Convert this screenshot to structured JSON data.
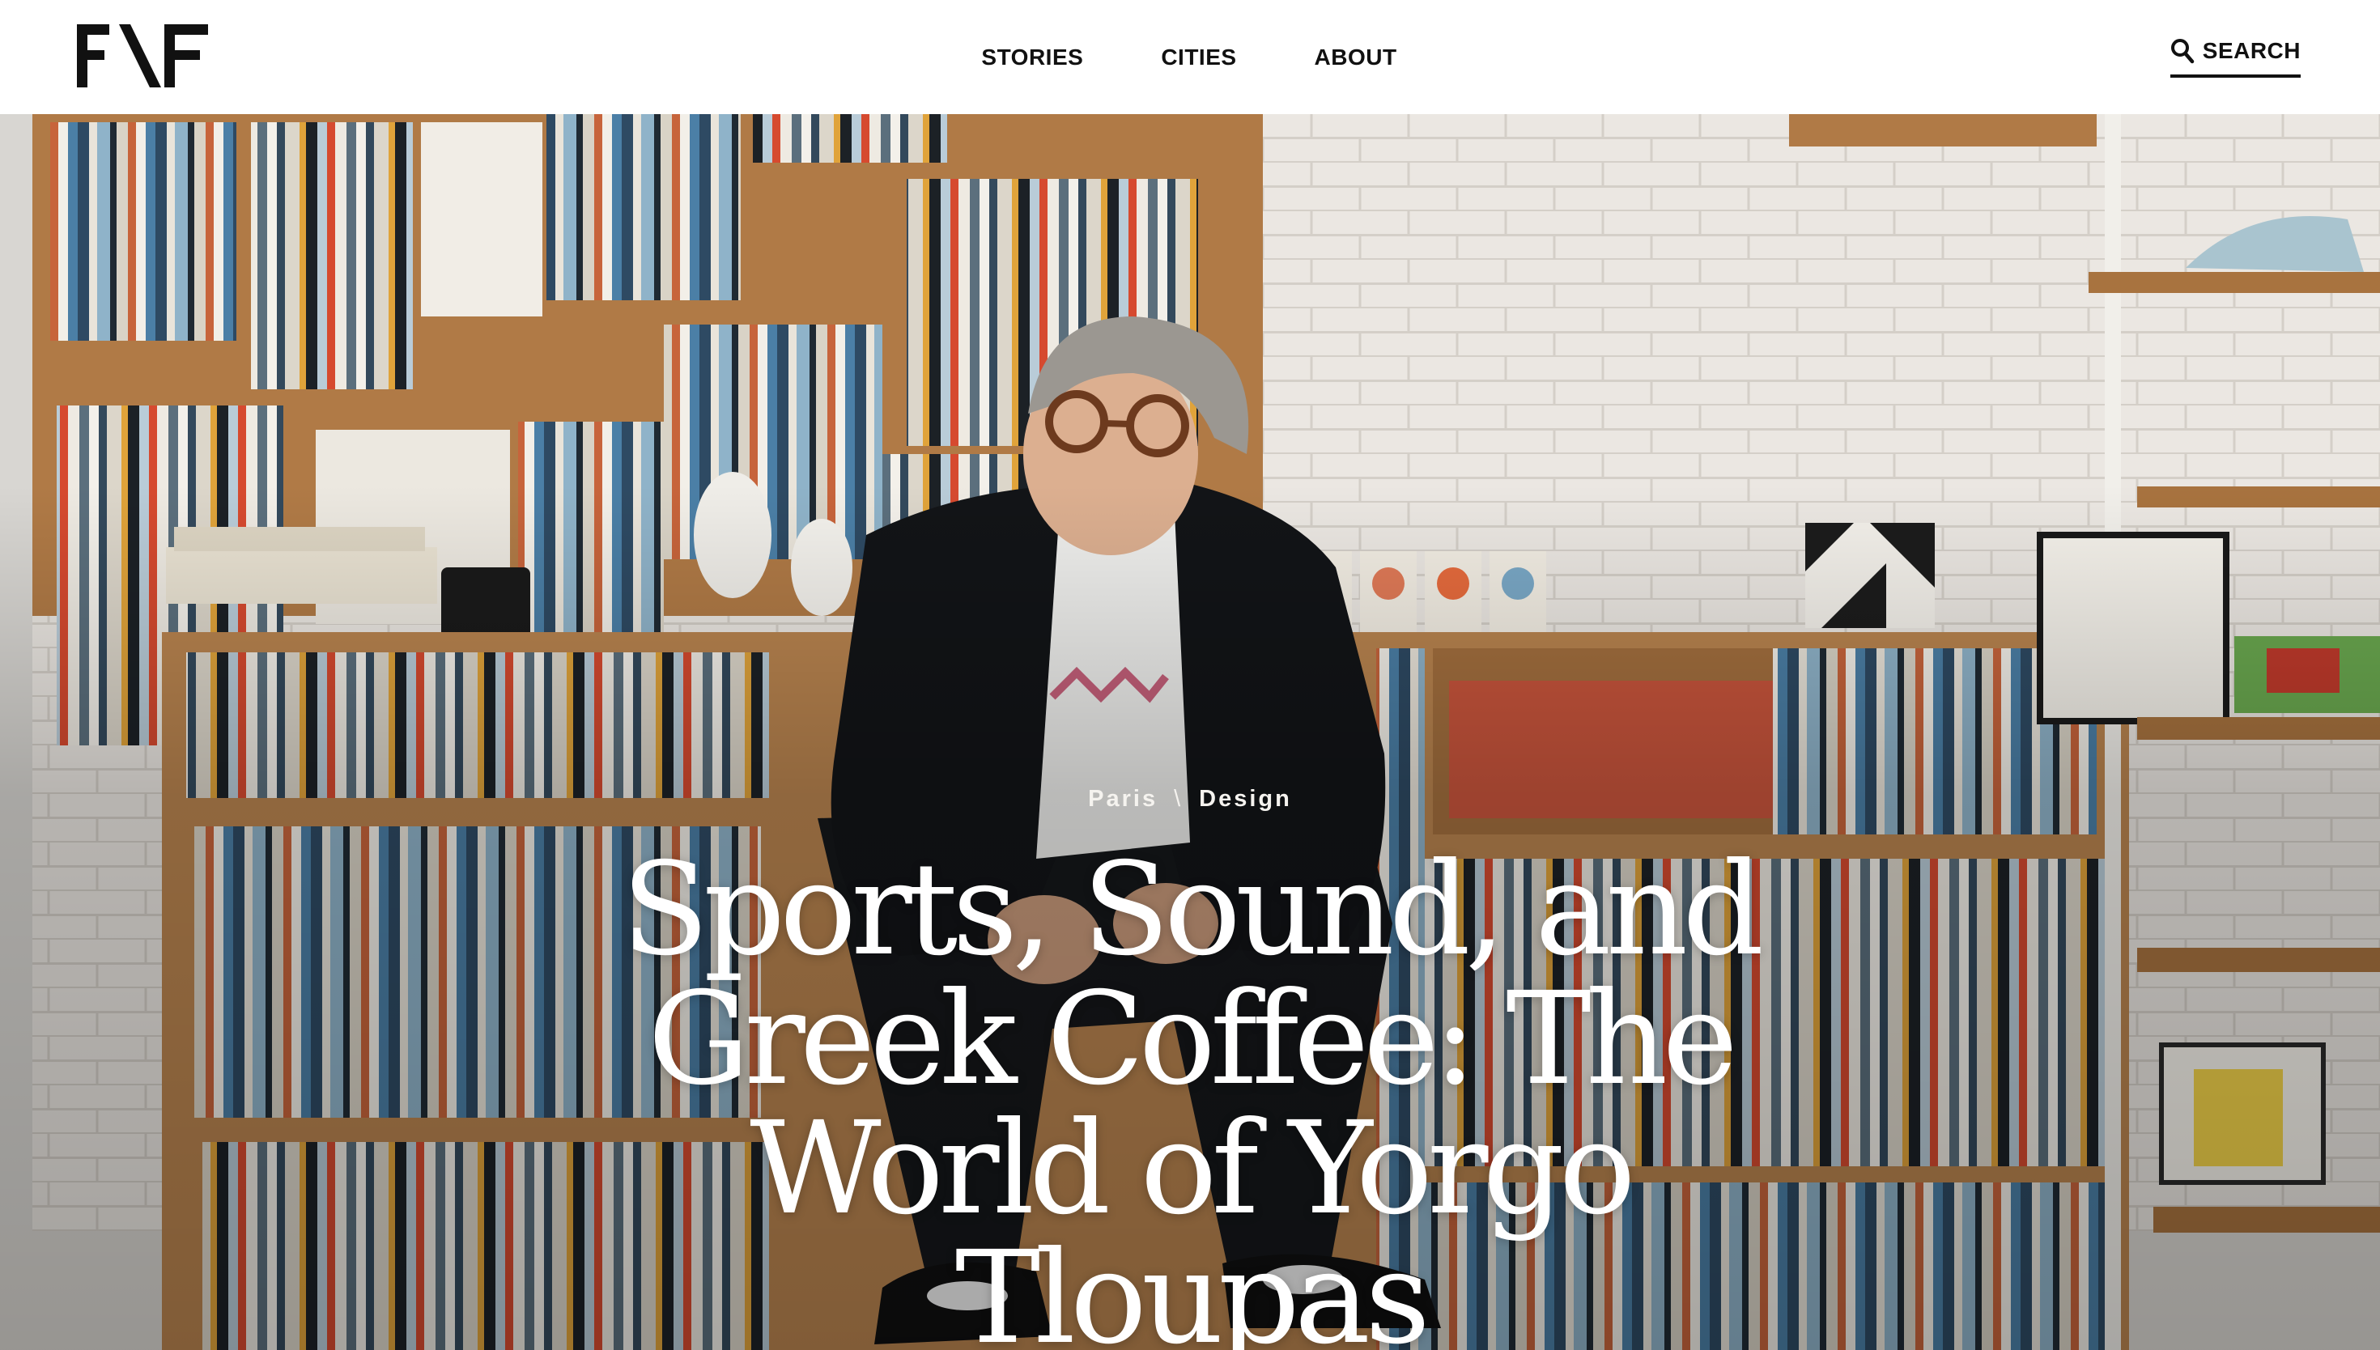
{
  "header": {
    "logo": {
      "text": "F\\F",
      "icon": "ff-logo"
    },
    "nav": [
      {
        "label": "STORIES"
      },
      {
        "label": "CITIES"
      },
      {
        "label": "ABOUT"
      }
    ],
    "search": {
      "label": "SEARCH",
      "icon": "search-icon"
    }
  },
  "hero": {
    "categories": [
      "Paris",
      "Design"
    ],
    "separator": "\\",
    "headline": "Sports, Sound, and Greek Coffee: The World of Yorgo Tloupas"
  }
}
